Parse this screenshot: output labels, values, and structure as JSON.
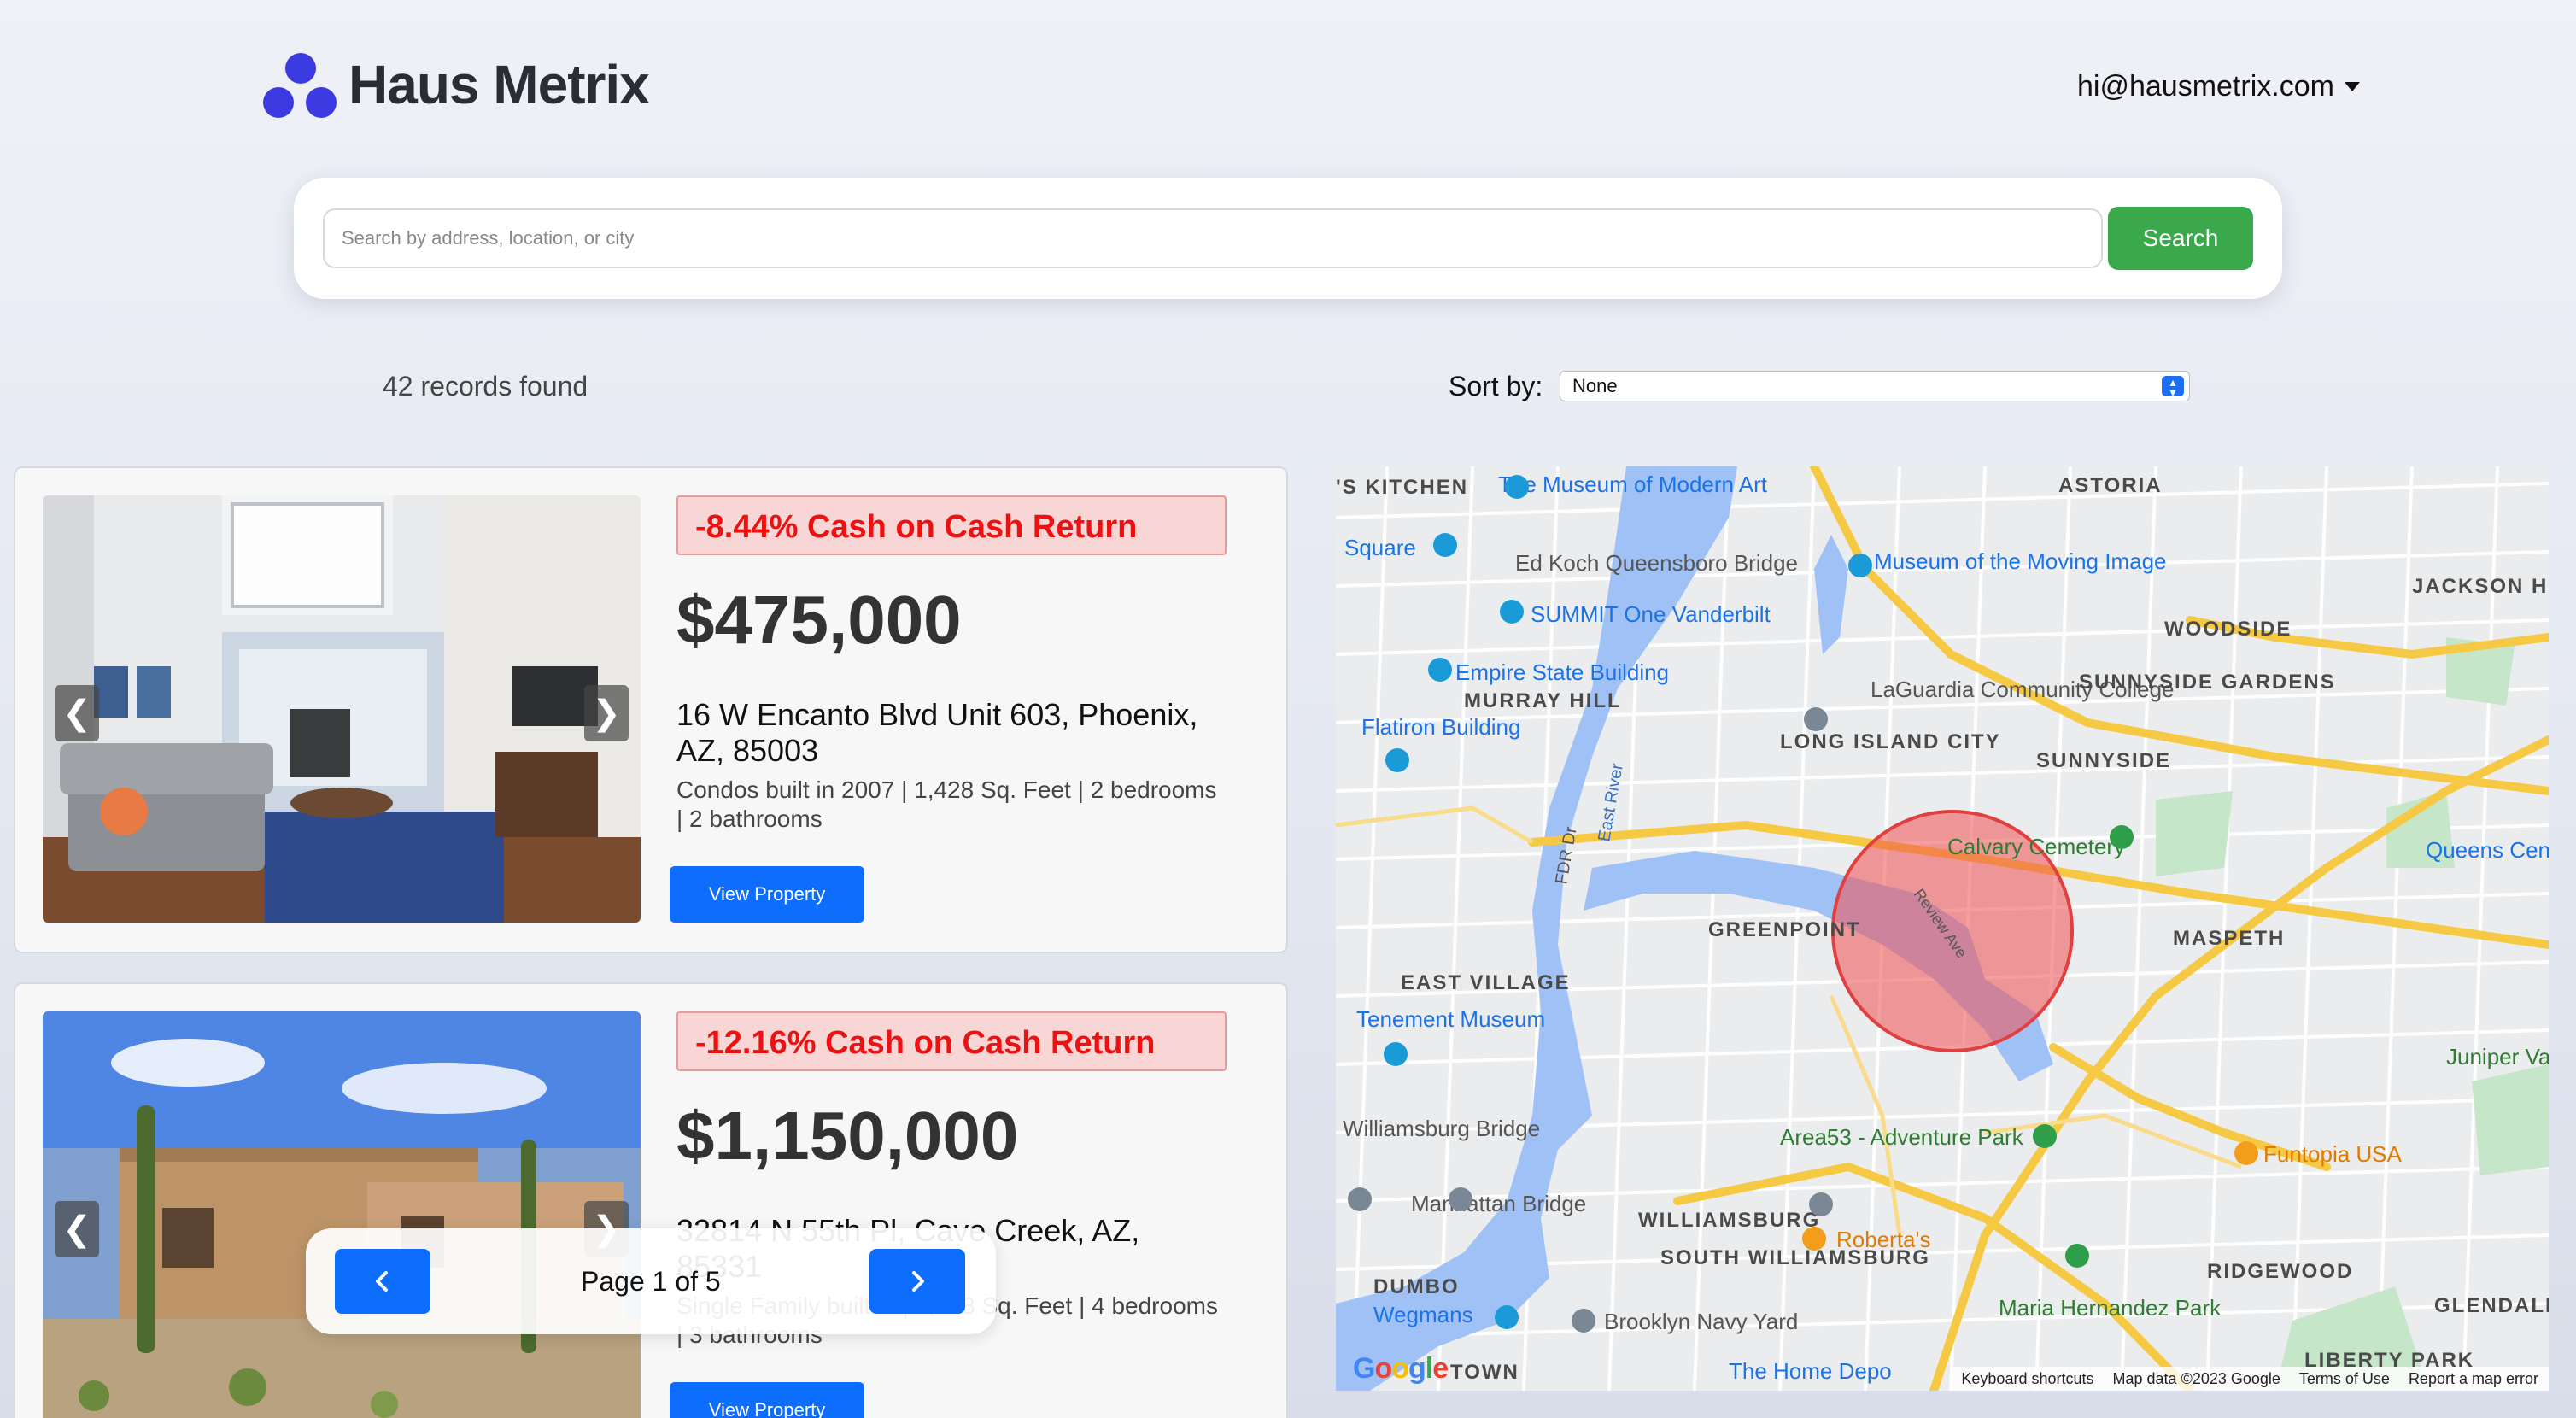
{
  "header": {
    "brand": "Haus Metrix",
    "user_email": "hi@hausmetrix.com"
  },
  "search": {
    "placeholder": "Search by address, location, or city",
    "value": "",
    "button_label": "Search"
  },
  "results": {
    "count_text": "42 records found",
    "sort_label": "Sort by:",
    "sort_value": "None"
  },
  "listings": [
    {
      "coc": "-8.44% Cash on Cash Return",
      "price": "$475,000",
      "address": "16 W Encanto Blvd Unit 603, Phoenix, AZ, 85003",
      "details": "Condos built in 2007 | 1,428 Sq. Feet | 2 bedrooms | 2 bathrooms",
      "button": "View Property"
    },
    {
      "coc": "-12.16% Cash on Cash Return",
      "price": "$1,150,000",
      "address": "32814 N 55th Pl, Cave Creek, AZ, 85331",
      "details": "Single Family built in | 3,128 Sq. Feet | 4 bedrooms | 3 bathrooms",
      "button": "View Property"
    }
  ],
  "pagination": {
    "text": "Page 1 of 5"
  },
  "map": {
    "labels": {
      "astoria": "ASTORIA",
      "museum_modern_art": "The Museum of Modern Art",
      "kitchen": "'S KITCHEN",
      "square": "Square",
      "ed_koch": "Ed Koch Queensboro Bridge",
      "summit": "SUMMIT One Vanderbilt",
      "museum_moving_image": "Museum of the Moving Image",
      "jackson_heights": "JACKSON HEIGHTS",
      "woodside": "WOODSIDE",
      "empire_state": "Empire State Building",
      "murray_hill": "MURRAY HILL",
      "laguardia": "LaGuardia Community College",
      "sunnyside_gardens": "SUNNYSIDE GARDENS",
      "flatiron": "Flatiron Building",
      "lic": "LONG ISLAND CITY",
      "sunnyside": "SUNNYSIDE",
      "calvary": "Calvary Cemetery",
      "queens_center": "Queens Cen",
      "greenpoint": "GREENPOINT",
      "maspeth": "MASPETH",
      "east_village": "EAST VILLAGE",
      "tenement": "Tenement Museum",
      "juniper": "Juniper Valley Park",
      "williamsburg_bridge": "Williamsburg Bridge",
      "area53": "Area53 - Adventure Park",
      "funtopia": "Funtopia USA",
      "manhattan_bridge": "Manhattan Bridge",
      "williamsburg": "WILLIAMSBURG",
      "robertas": "Roberta's",
      "south_williamsburg": "SOUTH WILLIAMSBURG",
      "ridgewood": "RIDGEWOOD",
      "dumbo": "DUMBO",
      "wegmans": "Wegmans",
      "navy_yard": "Brooklyn Navy Yard",
      "maria_hernandez": "Maria Hernandez Park",
      "glendale": "GLENDALE",
      "home_depot": "The Home Depo",
      "liberty_park": "LIBERTY PARK",
      "town": "TOWN",
      "east_river": "East River",
      "fdr": "FDR Dr",
      "review_ave": "Review Ave"
    },
    "footer": {
      "shortcuts": "Keyboard shortcuts",
      "map_data": "Map data ©2023 Google",
      "terms": "Terms of Use",
      "report": "Report a map error"
    },
    "google": "Google"
  },
  "colors": {
    "brand": "#3b3ae0",
    "search_button": "#39a94c",
    "primary_button": "#0d6efd",
    "negative": "#ee1111",
    "water": "#9fc1f5",
    "park": "#c5e6c9",
    "highway": "#f6c944"
  }
}
